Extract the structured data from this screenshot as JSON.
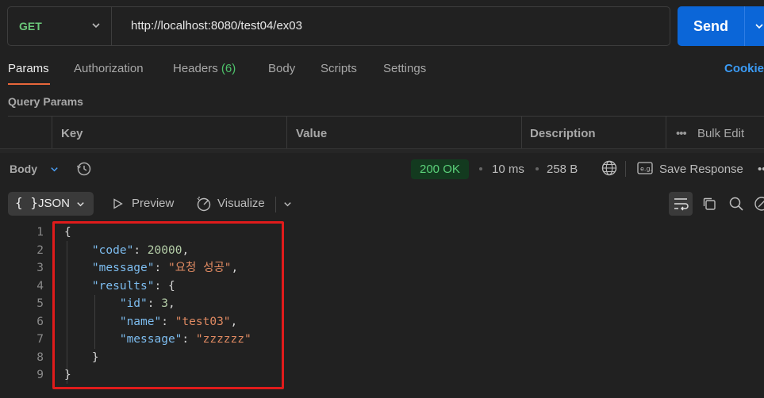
{
  "request": {
    "method": "GET",
    "url": "http://localhost:8080/test04/ex03",
    "send_label": "Send"
  },
  "tabs": [
    {
      "label": "Params",
      "active": true
    },
    {
      "label": "Authorization"
    },
    {
      "label": "Headers",
      "count": "(6)"
    },
    {
      "label": "Body"
    },
    {
      "label": "Scripts"
    },
    {
      "label": "Settings"
    }
  ],
  "cookies_label": "Cookie",
  "query_params": {
    "title": "Query Params",
    "columns": [
      "Key",
      "Value",
      "Description"
    ],
    "bulk_edit": "Bulk Edit"
  },
  "response": {
    "body_label": "Body",
    "status": "200 OK",
    "time": "10 ms",
    "size": "258 B",
    "save_label": "Save Response",
    "format": "JSON",
    "format_brace": "{ }",
    "preview_label": "Preview",
    "visualize_label": "Visualize"
  },
  "code_lines": [
    {
      "n": "1"
    },
    {
      "n": "2"
    },
    {
      "n": "3"
    },
    {
      "n": "4"
    },
    {
      "n": "5"
    },
    {
      "n": "6"
    },
    {
      "n": "7"
    },
    {
      "n": "8"
    },
    {
      "n": "9"
    }
  ],
  "json_body": {
    "open": "{",
    "code_key": "\"code\"",
    "code_val": "20000",
    "message_key": "\"message\"",
    "message_val": "\"요청 성공\"",
    "results_key": "\"results\"",
    "results_open": "{",
    "id_key": "\"id\"",
    "id_val": "3",
    "name_key": "\"name\"",
    "name_val": "\"test03\"",
    "msg2_key": "\"message\"",
    "msg2_val": "\"zzzzzz\"",
    "results_close": "}",
    "close": "}"
  },
  "colors": {
    "accent_send": "#0b66d8",
    "method_get": "#6bc87a",
    "status_ok": "#5bd17a",
    "tab_underline": "#e8663a",
    "highlight": "#e01b1b"
  }
}
